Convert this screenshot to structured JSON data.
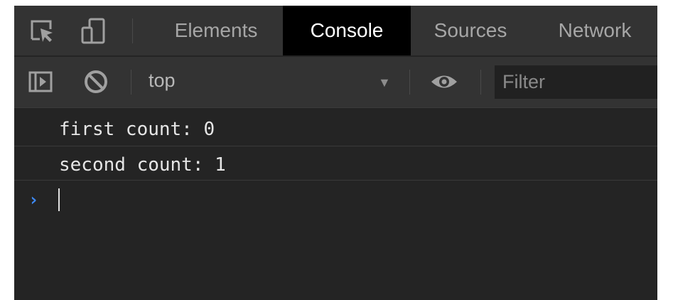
{
  "tabs": [
    {
      "label": "Elements",
      "active": false
    },
    {
      "label": "Console",
      "active": true
    },
    {
      "label": "Sources",
      "active": false
    },
    {
      "label": "Network",
      "active": false
    }
  ],
  "toolbar": {
    "icons": [
      "sidebar-toggle-icon",
      "clear-console-icon",
      "eye-icon"
    ],
    "context_selector": "top",
    "filter_placeholder": "Filter"
  },
  "header_icons": [
    "inspect-element-icon",
    "device-toolbar-icon"
  ],
  "console": {
    "messages": [
      "first count: 0",
      "second count: 1"
    ],
    "prompt_symbol": "›"
  },
  "colors": {
    "panel_bg": "#242424",
    "toolbar_bg": "#333333",
    "active_tab_bg": "#000000",
    "prompt_accent": "#3d8af7"
  }
}
